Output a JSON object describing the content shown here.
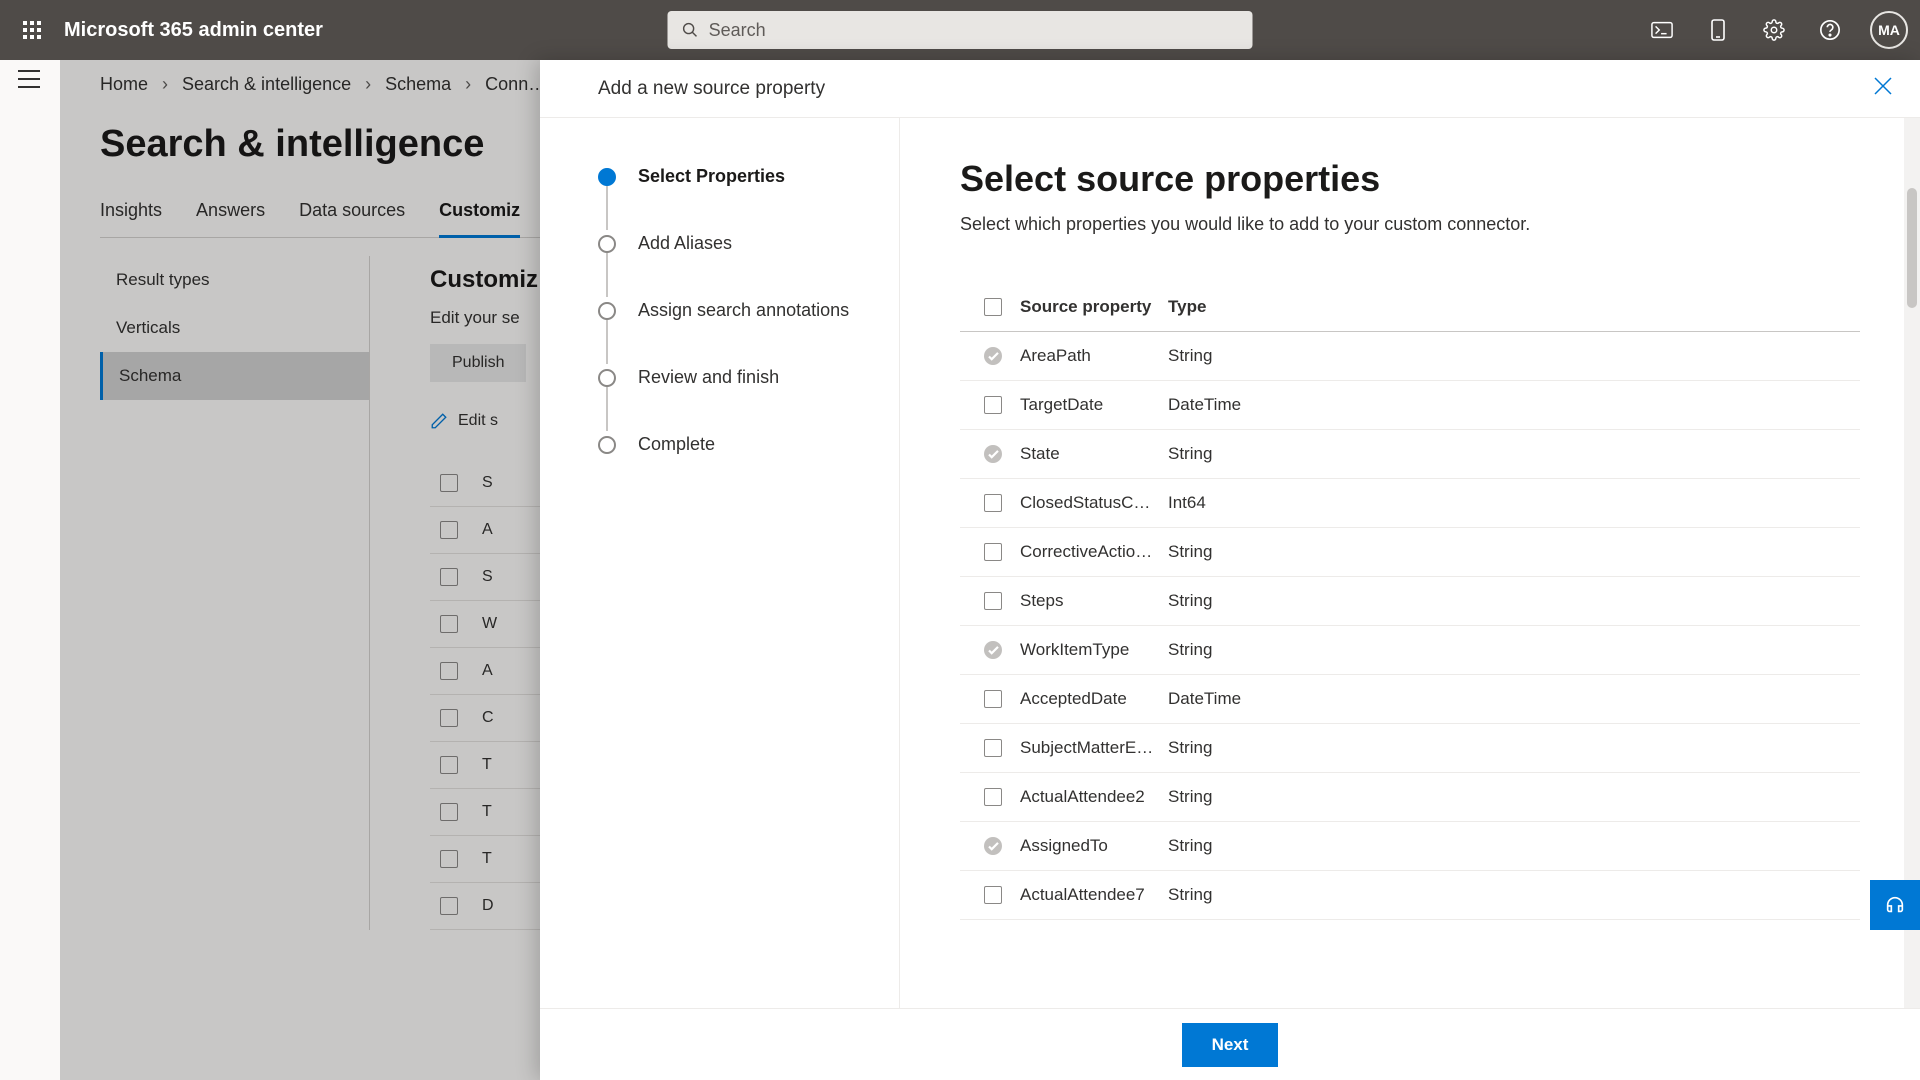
{
  "header": {
    "app_title": "Microsoft 365 admin center",
    "search_placeholder": "Search",
    "avatar_initials": "MA"
  },
  "breadcrumb": [
    "Home",
    "Search & intelligence",
    "Schema",
    "Conn…"
  ],
  "page_title": "Search & intelligence",
  "tabs": [
    "Insights",
    "Answers",
    "Data sources",
    "Customiz"
  ],
  "active_tab_index": 3,
  "sub_sidebar": {
    "items": [
      "Result types",
      "Verticals",
      "Schema"
    ],
    "active_index": 2
  },
  "schema_area": {
    "heading": "Customiz",
    "desc": "Edit your se",
    "publish_label": "Publish",
    "edit_label": "Edit s",
    "bg_header_first": "S",
    "bg_rows": [
      "A",
      "S",
      "W",
      "A",
      "C",
      "T",
      "T",
      "T",
      "D"
    ]
  },
  "panel": {
    "title": "Add a new source property",
    "steps": [
      "Select Properties",
      "Add Aliases",
      "Assign search annotations",
      "Review and finish",
      "Complete"
    ],
    "active_step_index": 0,
    "main_heading": "Select source properties",
    "main_sub": "Select which properties you would like to add to your custom connector.",
    "table": {
      "col_name": "Source property",
      "col_type": "Type",
      "rows": [
        {
          "name": "AreaPath",
          "type": "String",
          "selected": true
        },
        {
          "name": "TargetDate",
          "type": "DateTime",
          "selected": false
        },
        {
          "name": "State",
          "type": "String",
          "selected": true
        },
        {
          "name": "ClosedStatusCode",
          "type": "Int64",
          "selected": false
        },
        {
          "name": "CorrectiveAction…",
          "type": "String",
          "selected": false
        },
        {
          "name": "Steps",
          "type": "String",
          "selected": false
        },
        {
          "name": "WorkItemType",
          "type": "String",
          "selected": true
        },
        {
          "name": "AcceptedDate",
          "type": "DateTime",
          "selected": false
        },
        {
          "name": "SubjectMatterEx…",
          "type": "String",
          "selected": false
        },
        {
          "name": "ActualAttendee2",
          "type": "String",
          "selected": false
        },
        {
          "name": "AssignedTo",
          "type": "String",
          "selected": true
        },
        {
          "name": "ActualAttendee7",
          "type": "String",
          "selected": false
        }
      ]
    },
    "next_label": "Next"
  }
}
